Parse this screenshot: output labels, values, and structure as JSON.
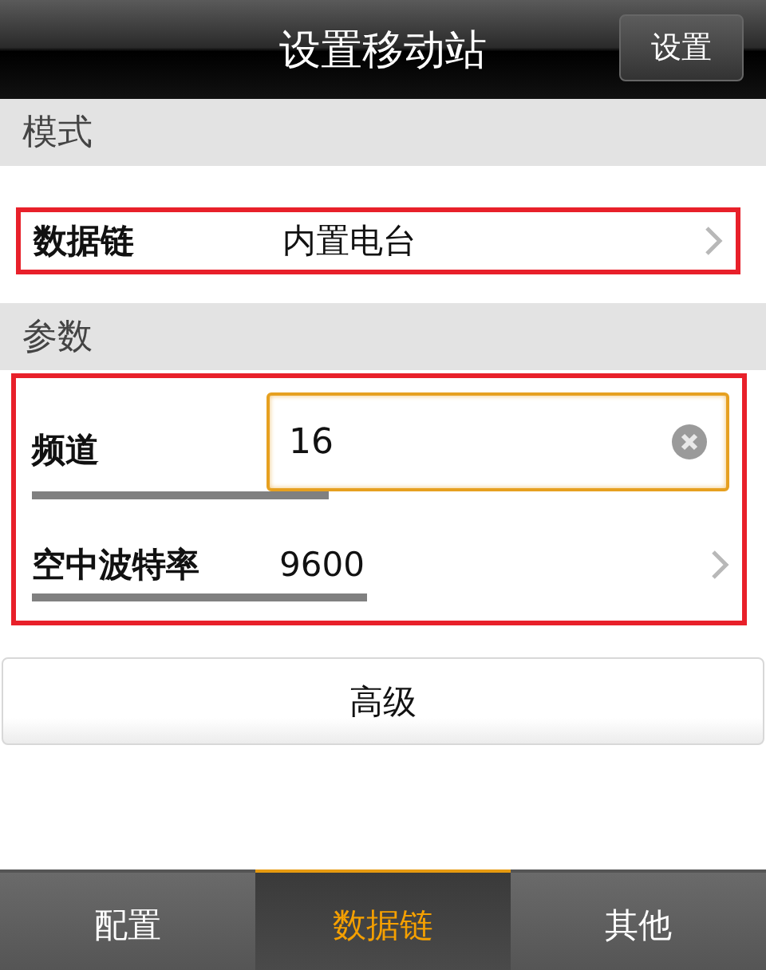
{
  "header": {
    "title": "设置移动站",
    "action_button": "设置"
  },
  "sections": [
    {
      "title": "模式",
      "highlighted": true,
      "rows": [
        {
          "kind": "select",
          "label": "数据链",
          "value": "内置电台",
          "underlined": false
        }
      ]
    },
    {
      "title": "参数",
      "highlighted": true,
      "rows": [
        {
          "kind": "input",
          "label": "频道",
          "value": "16",
          "focused": true,
          "underlined": true
        },
        {
          "kind": "select",
          "label": "空中波特率",
          "value": "9600",
          "underlined": true
        }
      ]
    }
  ],
  "advanced_button": "高级",
  "tabs": [
    {
      "label": "配置",
      "selected": false
    },
    {
      "label": "数据链",
      "selected": true
    },
    {
      "label": "其他",
      "selected": false
    }
  ]
}
